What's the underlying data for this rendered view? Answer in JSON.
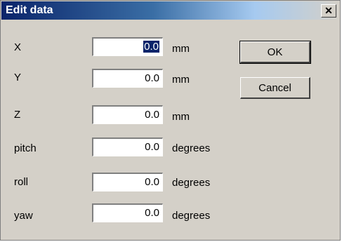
{
  "window": {
    "title": "Edit data",
    "close_label": "✕"
  },
  "fields": [
    {
      "label": "X",
      "value": "0.0",
      "unit": "mm",
      "selected": true
    },
    {
      "label": "Y",
      "value": "0.0",
      "unit": "mm"
    },
    {
      "label": "Z",
      "value": "0.0",
      "unit": "mm"
    },
    {
      "label": "pitch",
      "value": "0.0",
      "unit": "degrees"
    },
    {
      "label": "roll",
      "value": "0.0",
      "unit": "degrees"
    },
    {
      "label": "yaw",
      "value": "0.0",
      "unit": "degrees"
    }
  ],
  "buttons": {
    "ok_label": "OK",
    "cancel_label": "Cancel"
  },
  "colors": {
    "title_bar": "#0a246a",
    "dialog_bg": "#d4d0c8",
    "selection": "#0a246a"
  }
}
